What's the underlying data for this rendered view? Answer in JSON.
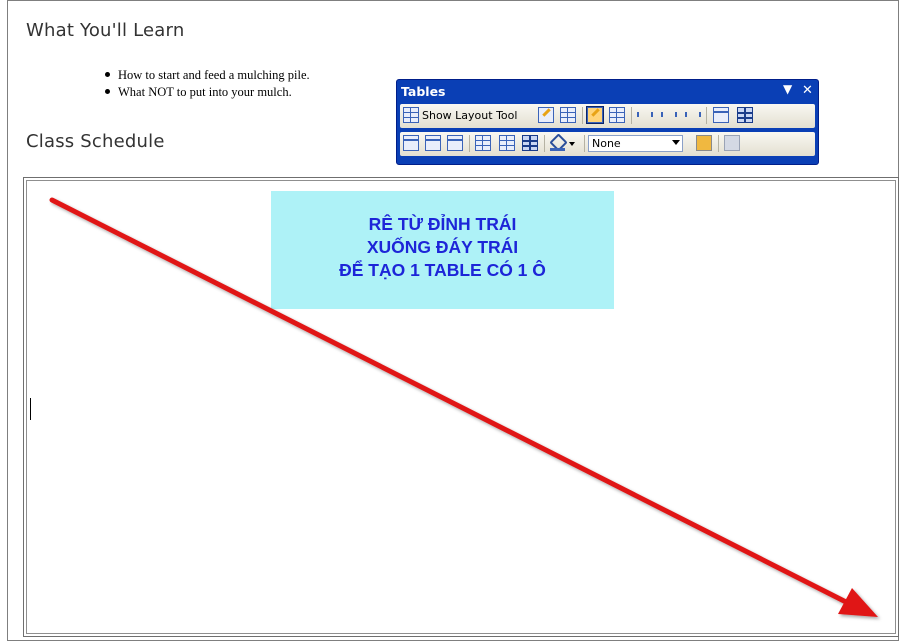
{
  "page": {
    "heading_learn": "What You'll Learn",
    "heading_schedule": "Class Schedule",
    "bullets": [
      "How to start and feed a mulching pile.",
      "What NOT to put into your mulch."
    ]
  },
  "toolbar": {
    "title": "Tables",
    "menu_glyph": "▼",
    "close_glyph": "✕",
    "show_layout_tool_label": "Show Layout Tool",
    "border_select_value": "None",
    "accent_color": "#0a3fb5"
  },
  "annotation": {
    "line1": "RÊ TỪ ĐỈNH TRÁI",
    "line2": "XUỐNG ĐÁY TRÁI",
    "line3": "ĐỂ TẠO 1 TABLE CÓ 1 Ô",
    "text_color": "#1d25d8",
    "background_color": "#aef2f7",
    "arrow_color": "#e01818"
  }
}
